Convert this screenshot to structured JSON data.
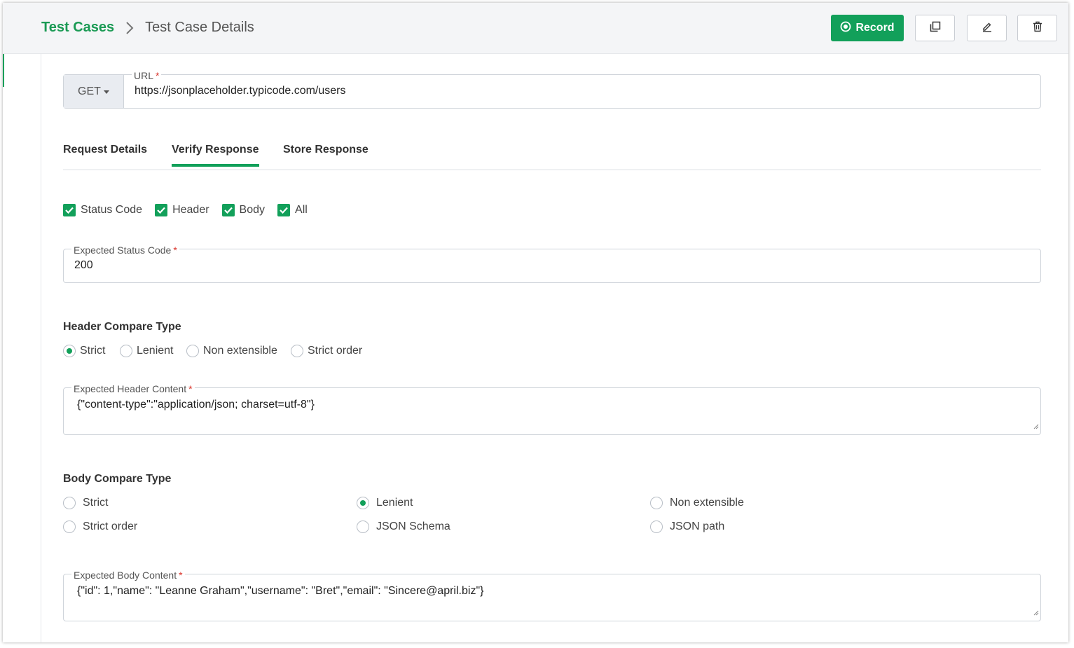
{
  "breadcrumb": {
    "root": "Test Cases",
    "current": "Test Case Details"
  },
  "toolbar": {
    "record_label": "Record"
  },
  "request": {
    "method": "GET",
    "url_label": "URL",
    "url_value": "https://jsonplaceholder.typicode.com/users"
  },
  "tabs": [
    {
      "label": "Request Details"
    },
    {
      "label": "Verify Response",
      "active": true
    },
    {
      "label": "Store Response"
    }
  ],
  "verify_checks": [
    {
      "label": "Status Code",
      "checked": true
    },
    {
      "label": "Header",
      "checked": true
    },
    {
      "label": "Body",
      "checked": true
    },
    {
      "label": "All",
      "checked": true
    }
  ],
  "status_code": {
    "label": "Expected Status Code",
    "value": "200"
  },
  "header_compare": {
    "title": "Header Compare Type",
    "options": [
      "Strict",
      "Lenient",
      "Non extensible",
      "Strict order"
    ],
    "selected": "Strict"
  },
  "header_content": {
    "label": "Expected Header Content",
    "value": "{\"content-type\":\"application/json; charset=utf-8\"}"
  },
  "body_compare": {
    "title": "Body Compare Type",
    "options": [
      "Strict",
      "Lenient",
      "Non extensible",
      "Strict order",
      "JSON Schema",
      "JSON path"
    ],
    "selected": "Lenient"
  },
  "body_content": {
    "label": "Expected Body Content",
    "value": "{\"id\": 1,\"name\": \"Leanne Graham\",\"username\": \"Bret\",\"email\": \"Sincere@april.biz\"}"
  },
  "colors": {
    "accent": "#12a05a",
    "required": "#d9342b"
  },
  "icons": {
    "record": "record-circle-icon",
    "copy": "copy-icon",
    "edit": "pencil-icon",
    "delete": "trash-icon",
    "separator": "chevron-right-icon"
  }
}
